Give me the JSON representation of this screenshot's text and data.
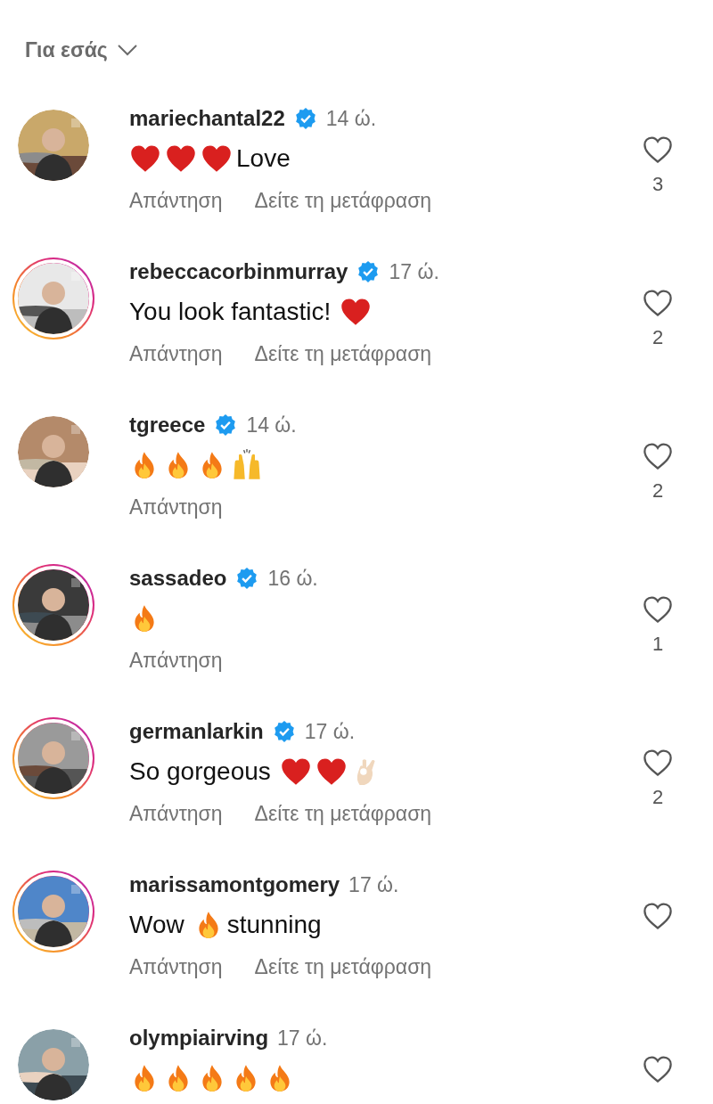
{
  "header": {
    "label": "Για εσάς"
  },
  "comments": [
    {
      "username": "mariechantal22",
      "verified": true,
      "time": "14 ώ.",
      "story_ring": false,
      "avatar": {
        "kind": "picture"
      },
      "body": [
        {
          "kind": "heart"
        },
        {
          "kind": "heart"
        },
        {
          "kind": "heart"
        },
        {
          "kind": "text",
          "text": "Love"
        }
      ],
      "actions": [
        "Απάντηση",
        "Δείτε τη μετάφραση"
      ],
      "likes": "3"
    },
    {
      "username": "rebeccacorbinmurray",
      "verified": true,
      "time": "17 ώ.",
      "story_ring": true,
      "avatar": {
        "kind": "picture"
      },
      "body": [
        {
          "kind": "text",
          "text": "You look fantastic!"
        },
        {
          "kind": "heart"
        }
      ],
      "actions": [
        "Απάντηση",
        "Δείτε τη μετάφραση"
      ],
      "likes": "2"
    },
    {
      "username": "tgreece",
      "verified": true,
      "time": "14 ώ.",
      "story_ring": false,
      "avatar": {
        "kind": "picture"
      },
      "body": [
        {
          "kind": "fire"
        },
        {
          "kind": "fire"
        },
        {
          "kind": "fire"
        },
        {
          "kind": "raised_hands"
        }
      ],
      "actions": [
        "Απάντηση"
      ],
      "likes": "2"
    },
    {
      "username": "sassadeo",
      "verified": true,
      "time": "16 ώ.",
      "story_ring": true,
      "avatar": {
        "kind": "picture"
      },
      "body": [
        {
          "kind": "fire"
        }
      ],
      "actions": [
        "Απάντηση"
      ],
      "likes": "1"
    },
    {
      "username": "germanlarkin",
      "verified": true,
      "time": "17 ώ.",
      "story_ring": true,
      "avatar": {
        "kind": "picture"
      },
      "body": [
        {
          "kind": "text",
          "text": "So gorgeous"
        },
        {
          "kind": "heart"
        },
        {
          "kind": "heart"
        },
        {
          "kind": "ok_hand"
        }
      ],
      "actions": [
        "Απάντηση",
        "Δείτε τη μετάφραση"
      ],
      "likes": "2"
    },
    {
      "username": "marissamontgomery",
      "verified": false,
      "time": "17 ώ.",
      "story_ring": true,
      "avatar": {
        "kind": "picture"
      },
      "body": [
        {
          "kind": "text",
          "text": "Wow"
        },
        {
          "kind": "fire"
        },
        {
          "kind": "text",
          "text": "stunning"
        }
      ],
      "actions": [
        "Απάντηση",
        "Δείτε τη μετάφραση"
      ]
    },
    {
      "username": "olympiairving",
      "verified": false,
      "time": "17 ώ.",
      "story_ring": false,
      "avatar": {
        "kind": "picture"
      },
      "body": [
        {
          "kind": "fire"
        },
        {
          "kind": "fire"
        },
        {
          "kind": "fire"
        },
        {
          "kind": "fire"
        },
        {
          "kind": "fire"
        }
      ]
    }
  ]
}
